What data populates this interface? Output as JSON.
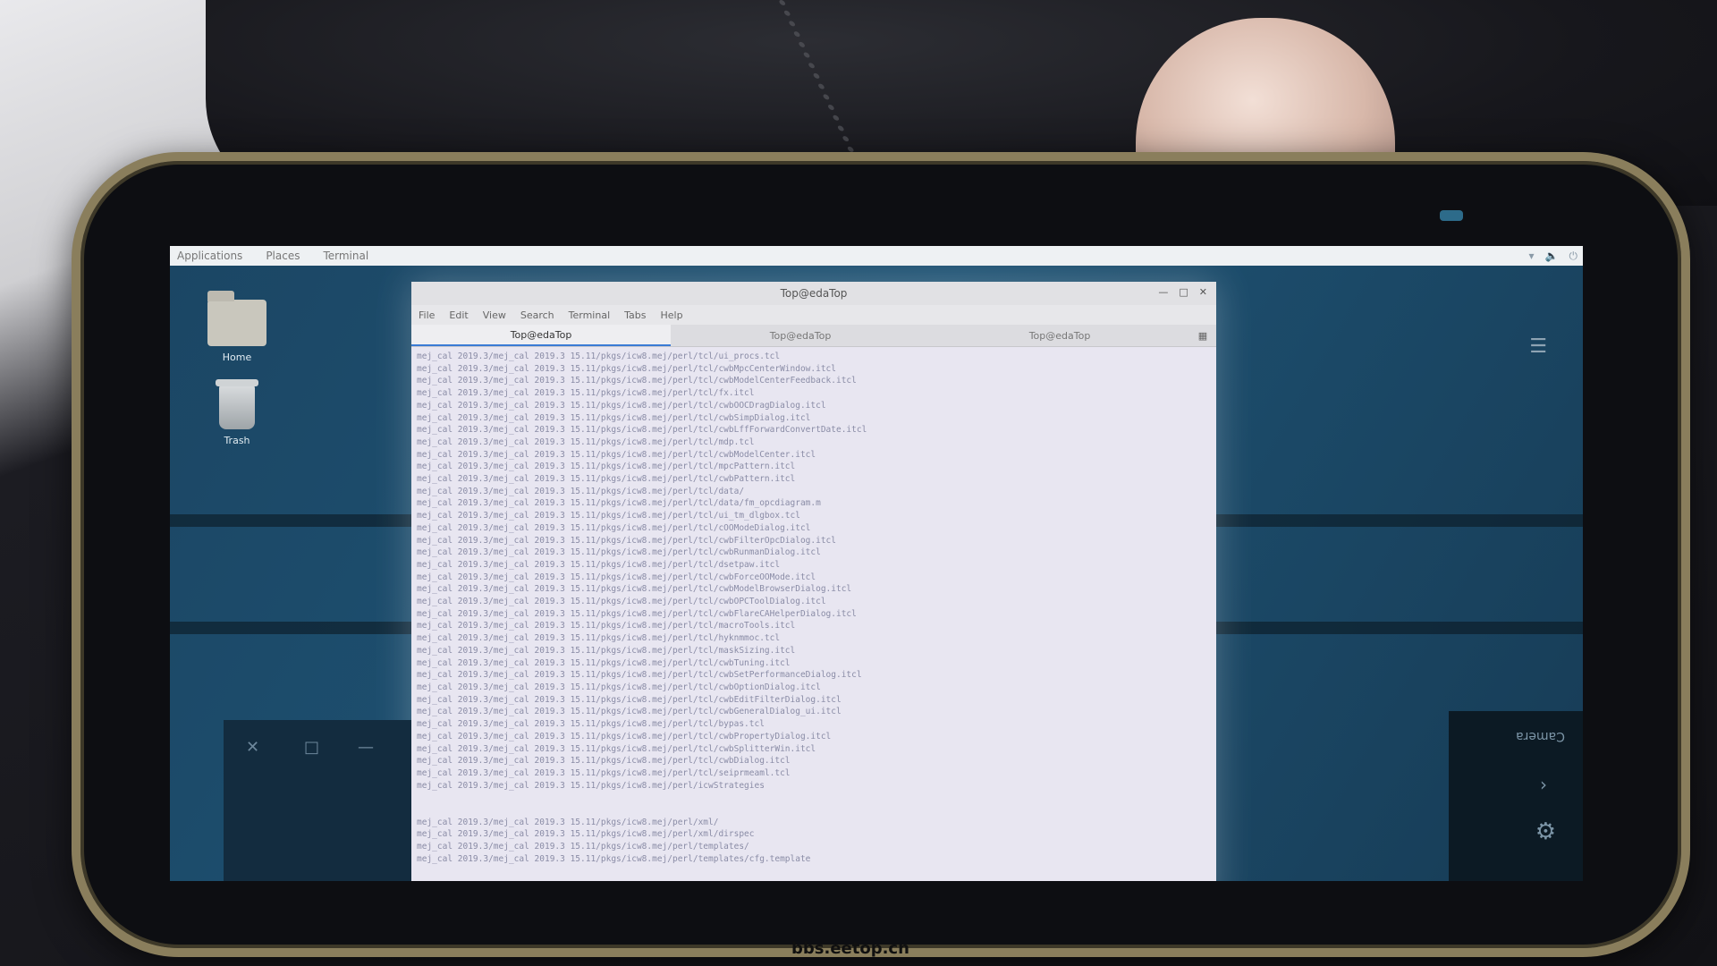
{
  "topbar": {
    "applications": "Applications",
    "places": "Places",
    "terminal": "Terminal"
  },
  "desktop": {
    "home_label": "Home",
    "trash_label": "Trash"
  },
  "terminal": {
    "title": "Top@edaTop",
    "menu": [
      "File",
      "Edit",
      "View",
      "Search",
      "Terminal",
      "Tabs",
      "Help"
    ],
    "tabs": [
      "Top@edaTop",
      "Top@edaTop",
      "Top@edaTop"
    ],
    "lines": [
      "mej_cal 2019.3/mej_cal 2019.3 15.11/pkgs/icw8.mej/perl/tcl/ui_procs.tcl",
      "mej_cal 2019.3/mej_cal 2019.3 15.11/pkgs/icw8.mej/perl/tcl/cwbMpcCenterWindow.itcl",
      "mej_cal 2019.3/mej_cal 2019.3 15.11/pkgs/icw8.mej/perl/tcl/cwbModelCenterFeedback.itcl",
      "mej_cal 2019.3/mej_cal 2019.3 15.11/pkgs/icw8.mej/perl/tcl/fx.itcl",
      "mej_cal 2019.3/mej_cal 2019.3 15.11/pkgs/icw8.mej/perl/tcl/cwbOOCDragDialog.itcl",
      "mej_cal 2019.3/mej_cal 2019.3 15.11/pkgs/icw8.mej/perl/tcl/cwbSimpDialog.itcl",
      "mej_cal 2019.3/mej_cal 2019.3 15.11/pkgs/icw8.mej/perl/tcl/cwbLffForwardConvertDate.itcl",
      "mej_cal 2019.3/mej_cal 2019.3 15.11/pkgs/icw8.mej/perl/tcl/mdp.tcl",
      "mej_cal 2019.3/mej_cal 2019.3 15.11/pkgs/icw8.mej/perl/tcl/cwbModelCenter.itcl",
      "mej_cal 2019.3/mej_cal 2019.3 15.11/pkgs/icw8.mej/perl/tcl/mpcPattern.itcl",
      "mej_cal 2019.3/mej_cal 2019.3 15.11/pkgs/icw8.mej/perl/tcl/cwbPattern.itcl",
      "mej_cal 2019.3/mej_cal 2019.3 15.11/pkgs/icw8.mej/perl/tcl/data/",
      "mej_cal 2019.3/mej_cal 2019.3 15.11/pkgs/icw8.mej/perl/tcl/data/fm_opcdiagram.m",
      "mej_cal 2019.3/mej_cal 2019.3 15.11/pkgs/icw8.mej/perl/tcl/ui_tm_dlgbox.tcl",
      "mej_cal 2019.3/mej_cal 2019.3 15.11/pkgs/icw8.mej/perl/tcl/cOOModeDialog.itcl",
      "mej_cal 2019.3/mej_cal 2019.3 15.11/pkgs/icw8.mej/perl/tcl/cwbFilterOpcDialog.itcl",
      "mej_cal 2019.3/mej_cal 2019.3 15.11/pkgs/icw8.mej/perl/tcl/cwbRunmanDialog.itcl",
      "mej_cal 2019.3/mej_cal 2019.3 15.11/pkgs/icw8.mej/perl/tcl/dsetpaw.itcl",
      "mej_cal 2019.3/mej_cal 2019.3 15.11/pkgs/icw8.mej/perl/tcl/cwbForceOOMode.itcl",
      "mej_cal 2019.3/mej_cal 2019.3 15.11/pkgs/icw8.mej/perl/tcl/cwbModelBrowserDialog.itcl",
      "mej_cal 2019.3/mej_cal 2019.3 15.11/pkgs/icw8.mej/perl/tcl/cwbOPCToolDialog.itcl",
      "mej_cal 2019.3/mej_cal 2019.3 15.11/pkgs/icw8.mej/perl/tcl/cwbFlareCAHelperDialog.itcl",
      "mej_cal 2019.3/mej_cal 2019.3 15.11/pkgs/icw8.mej/perl/tcl/macroTools.itcl",
      "mej_cal 2019.3/mej_cal 2019.3 15.11/pkgs/icw8.mej/perl/tcl/hyknmmoc.tcl",
      "mej_cal 2019.3/mej_cal 2019.3 15.11/pkgs/icw8.mej/perl/tcl/maskSizing.itcl",
      "mej_cal 2019.3/mej_cal 2019.3 15.11/pkgs/icw8.mej/perl/tcl/cwbTuning.itcl",
      "mej_cal 2019.3/mej_cal 2019.3 15.11/pkgs/icw8.mej/perl/tcl/cwbSetPerformanceDialog.itcl",
      "mej_cal 2019.3/mej_cal 2019.3 15.11/pkgs/icw8.mej/perl/tcl/cwbOptionDialog.itcl",
      "mej_cal 2019.3/mej_cal 2019.3 15.11/pkgs/icw8.mej/perl/tcl/cwbEditFilterDialog.itcl",
      "mej_cal 2019.3/mej_cal 2019.3 15.11/pkgs/icw8.mej/perl/tcl/cwbGeneralDialog_ui.itcl",
      "mej_cal 2019.3/mej_cal 2019.3 15.11/pkgs/icw8.mej/perl/tcl/bypas.tcl",
      "mej_cal 2019.3/mej_cal 2019.3 15.11/pkgs/icw8.mej/perl/tcl/cwbPropertyDialog.itcl",
      "mej_cal 2019.3/mej_cal 2019.3 15.11/pkgs/icw8.mej/perl/tcl/cwbSplitterWin.itcl",
      "mej_cal 2019.3/mej_cal 2019.3 15.11/pkgs/icw8.mej/perl/tcl/cwbDialog.itcl",
      "mej_cal 2019.3/mej_cal 2019.3 15.11/pkgs/icw8.mej/perl/tcl/seiprmeaml.tcl",
      "mej_cal 2019.3/mej_cal 2019.3 15.11/pkgs/icw8.mej/perl/icwStrategies",
      "",
      "",
      "mej_cal 2019.3/mej_cal 2019.3 15.11/pkgs/icw8.mej/perl/xml/",
      "mej_cal 2019.3/mej_cal 2019.3 15.11/pkgs/icw8.mej/perl/xml/dirspec",
      "mej_cal 2019.3/mej_cal 2019.3 15.11/pkgs/icw8.mej/perl/templates/",
      "mej_cal 2019.3/mej_cal 2019.3 15.11/pkgs/icw8.mej/perl/templates/cfg.template"
    ]
  },
  "side_panel": {
    "camera_label": "Camera"
  },
  "watermark": "bbs.eetop.cn"
}
